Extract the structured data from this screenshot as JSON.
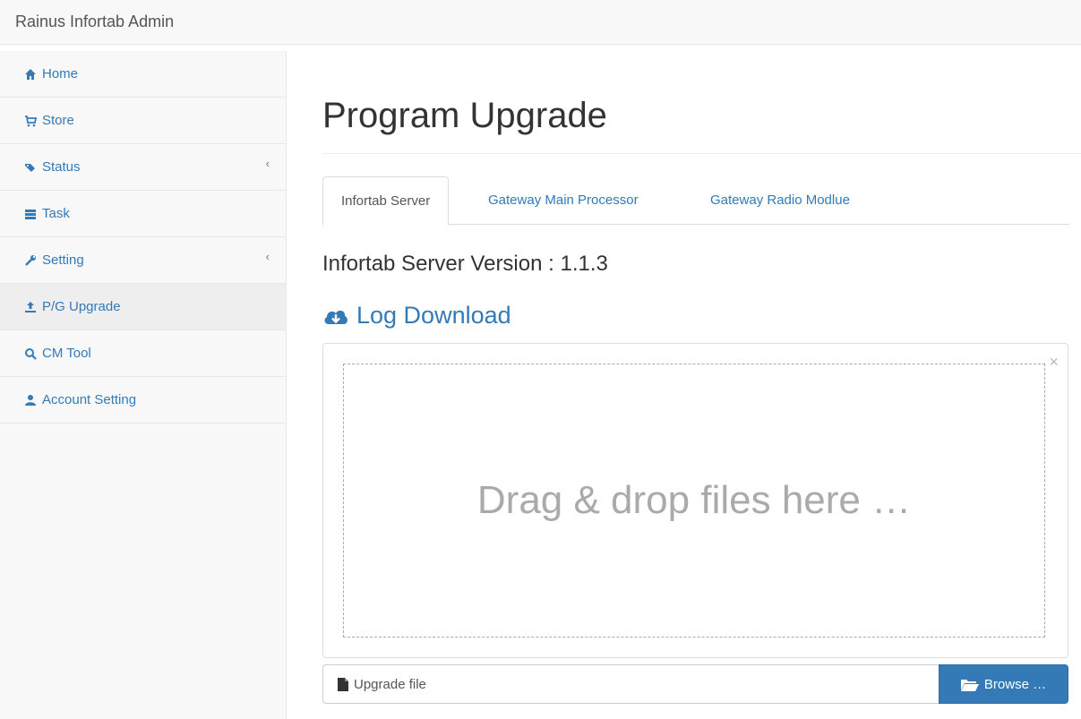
{
  "app": {
    "brand": "Rainus Infortab Admin"
  },
  "sidebar": {
    "items": [
      {
        "label": "Home",
        "icon": "home-icon"
      },
      {
        "label": "Store",
        "icon": "cart-icon"
      },
      {
        "label": "Status",
        "icon": "tags-icon",
        "chevron": "‹"
      },
      {
        "label": "Task",
        "icon": "list-icon"
      },
      {
        "label": "Setting",
        "icon": "wrench-icon",
        "chevron": "‹"
      },
      {
        "label": "P/G Upgrade",
        "icon": "upload-icon",
        "active": true
      },
      {
        "label": "CM Tool",
        "icon": "search-icon"
      },
      {
        "label": "Account Setting",
        "icon": "user-icon"
      }
    ]
  },
  "main": {
    "title": "Program Upgrade",
    "tabs": [
      {
        "label": "Infortab Server",
        "active": true
      },
      {
        "label": "Gateway Main Processor"
      },
      {
        "label": "Gateway Radio Modlue"
      }
    ],
    "version_text": "Infortab Server Version : 1.1.3",
    "log_download": {
      "label": "Log Download",
      "icon": "cloud-download-icon"
    },
    "dropzone": {
      "text": "Drag & drop files here …",
      "close": "×"
    },
    "file": {
      "placeholder": "Upgrade file",
      "browse_label": "Browse …",
      "file_icon": "file-icon",
      "browse_icon": "folder-open-icon"
    }
  },
  "colors": {
    "accent": "#337ab7",
    "sidebar_bg": "#f8f8f8",
    "active_bg": "#eeeeee"
  }
}
